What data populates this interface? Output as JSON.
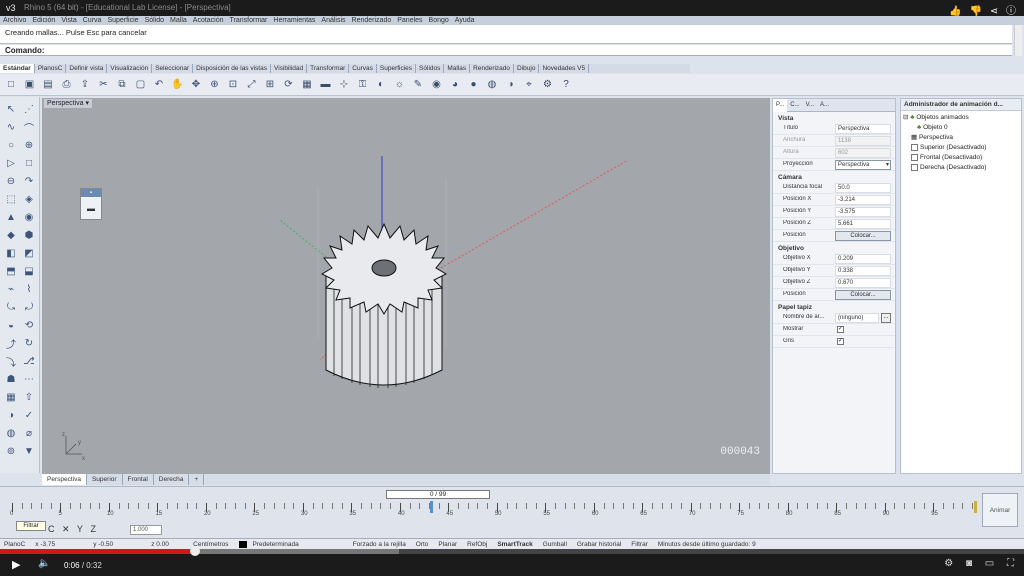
{
  "video": {
    "tag": "v3",
    "window_title": "Rhino 5 (64 bit) - [Educational Lab License] - [Perspectiva]",
    "time_current": "0:06",
    "time_total": "/ 0:32",
    "progress": 0.19,
    "buffered": 0.39
  },
  "menubar": [
    "Archivo",
    "Edición",
    "Vista",
    "Curva",
    "Superficie",
    "Sólido",
    "Malla",
    "Acotación",
    "Transformar",
    "Herramientas",
    "Análisis",
    "Renderizado",
    "Paneles",
    "Bongo",
    "Ayuda"
  ],
  "command": {
    "history": "Creando mallas... Pulse Esc para cancelar",
    "prompt": "Comando:"
  },
  "toolbar_tabs": [
    "Estándar",
    "PlanosC",
    "Definir vista",
    "Visualización",
    "Seleccionar",
    "Disposición de las vistas",
    "Visibilidad",
    "Transformar",
    "Curvas",
    "Superficies",
    "Sólidos",
    "Mallas",
    "Renderizado",
    "Dibujo",
    "Novedades V5"
  ],
  "toolbar_icons": [
    "new-icon",
    "open-icon",
    "save-icon",
    "print-icon",
    "import-icon",
    "cut-icon",
    "copy-icon",
    "paste-icon",
    "undo-icon",
    "pan-icon",
    "move-view-icon",
    "zoom-in-icon",
    "zoom-window-icon",
    "zoom-extents-icon",
    "zoom-selected-icon",
    "rotate-view-icon",
    "four-views-icon",
    "delete-icon",
    "grid-snap-icon",
    "lock-icon",
    "visibility-icon",
    "light-icon",
    "paint-icon",
    "materials-icon",
    "color-wheel-icon",
    "render-icon",
    "sphere-icon",
    "shade-icon",
    "camera-icon",
    "options-icon",
    "help-icon"
  ],
  "toolbar_glyphs": [
    "□",
    "▣",
    "▤",
    "⎙",
    "⇪",
    "✂",
    "⧉",
    "▢",
    "↶",
    "✋",
    "✥",
    "⊕",
    "⊡",
    "⤢",
    "⊞",
    "⟳",
    "▦",
    "▬",
    "⊹",
    "⚿",
    "◐",
    "☼",
    "✎",
    "◉",
    "◕",
    "●",
    "◍",
    "◑",
    "⌖",
    "⚙",
    "?"
  ],
  "left_tools": [
    "↖",
    "⋰",
    "∿",
    "⌒",
    "○",
    "⊕",
    "▷",
    "□",
    "⊖",
    "↷",
    "⬚",
    "◈",
    "▲",
    "◉",
    "◆",
    "⬢",
    "◧",
    "◩",
    "⬒",
    "⬓",
    "⌁",
    "⌇",
    "⤿",
    "⤾",
    "◒",
    "⟲",
    "⤴",
    "↻",
    "⤵",
    "⎇",
    "☗",
    "⋯",
    "▦",
    "⇧",
    "◑",
    "✓",
    "◍",
    "⌀",
    "⊚",
    "▼"
  ],
  "viewport": {
    "title": "Perspectiva",
    "float_value": "▬",
    "frame": "000043"
  },
  "view_tabs": [
    "Perspectiva",
    "Superior",
    "Frontal",
    "Derecha",
    "+"
  ],
  "properties": {
    "tabs": [
      "P...",
      "C...",
      "V...",
      "A..."
    ],
    "vista": {
      "heading": "Vista",
      "rows": [
        {
          "label": "Título",
          "value": "Perspectiva"
        },
        {
          "label": "Anchura",
          "value": "1138"
        },
        {
          "label": "Altura",
          "value": "602"
        }
      ],
      "proj_label": "Proyección",
      "proj_value": "Perspectiva"
    },
    "camara": {
      "heading": "Cámara",
      "rows": [
        {
          "label": "Distancia focal",
          "value": "50.0"
        },
        {
          "label": "Posición X",
          "value": "-3.214"
        },
        {
          "label": "Posición Y",
          "value": "-3.575"
        },
        {
          "label": "Posición Z",
          "value": "5.661"
        }
      ],
      "pos_label": "Posición",
      "pos_button": "Colocar..."
    },
    "objetivo": {
      "heading": "Objetivo",
      "rows": [
        {
          "label": "Objetivo X",
          "value": "0.209"
        },
        {
          "label": "Objetivo Y",
          "value": "0.338"
        },
        {
          "label": "Objetivo Z",
          "value": "0.670"
        }
      ],
      "pos_label": "Posición",
      "pos_button": "Colocar..."
    },
    "papel": {
      "heading": "Papel tapiz",
      "name_label": "Nombre de ar...",
      "name_value": "(ninguno)",
      "name_button": "...",
      "show_label": "Mostrar",
      "gray_label": "Gris",
      "check": "✓"
    }
  },
  "animation": {
    "title": "Administrador de animación d...",
    "tree": [
      "Objetos animados",
      "Objeto 0",
      "Perspectiva",
      "Superior (Desactivado)",
      "Frontal (Desactivado)",
      "Derecha (Desactivado)"
    ]
  },
  "timeline": {
    "field": "0 / 99",
    "labels": [
      "0",
      "5",
      "10",
      "15",
      "20",
      "25",
      "30",
      "35",
      "40",
      "45",
      "50",
      "55",
      "60",
      "65",
      "70",
      "75",
      "80",
      "85",
      "90",
      "95"
    ],
    "button": "Animar",
    "tooltip": "Filtrar",
    "mini_value": "1.000",
    "tools": [
      "C",
      "✕",
      "Y",
      "Z"
    ]
  },
  "status": {
    "plane": "PlanoC",
    "x": "x -3.75",
    "y": "y -0.50",
    "z": "z 0.00",
    "units": "Centímetros",
    "layer": "Predeterminada",
    "grid": "Forzado a la rejilla",
    "orto": "Orto",
    "planar": "Planar",
    "osnap": "RefObj",
    "smarttrack": "SmartTrack",
    "gumball": "Gumball",
    "history": "Grabar historial",
    "filter": "Filtrar",
    "saved": "Minutos desde último guardado: 9"
  }
}
